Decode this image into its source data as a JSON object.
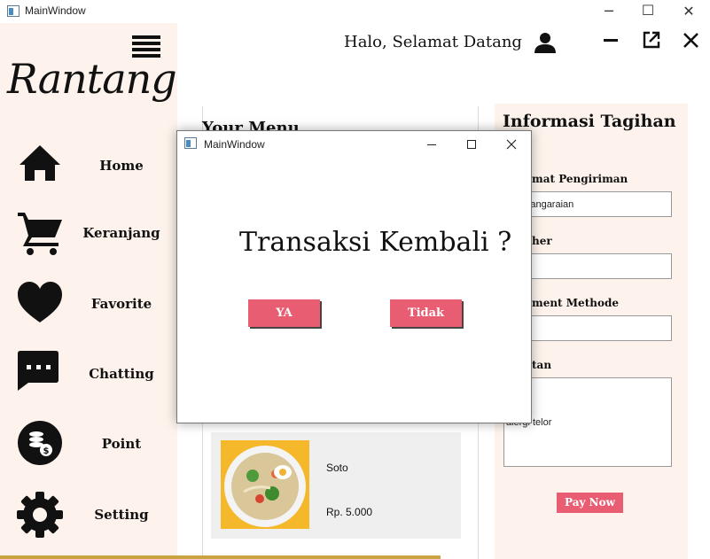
{
  "window": {
    "title": "MainWindow",
    "minimize": "─",
    "maximize": "☐",
    "close": "✕"
  },
  "app": {
    "logo": "Rantang",
    "greeting": "Halo, Selamat Datang",
    "header_minimize": "—",
    "header_popout": "⧉",
    "header_close": "✕"
  },
  "sidebar": {
    "items": [
      {
        "label": "Home",
        "icon": "home-icon"
      },
      {
        "label": "Keranjang",
        "icon": "cart-icon"
      },
      {
        "label": "Favorite",
        "icon": "heart-icon"
      },
      {
        "label": "Chatting",
        "icon": "chat-icon"
      },
      {
        "label": "Point",
        "icon": "coins-icon"
      },
      {
        "label": "Setting",
        "icon": "gear-icon"
      }
    ]
  },
  "menu": {
    "title": "Your Menu",
    "item": {
      "name": "Soto",
      "price": "Rp. 5.000"
    }
  },
  "billing": {
    "title": "Informasi Tagihan",
    "address_label": "mat Pengiriman",
    "address_value": "Pangaraian",
    "voucher_label": "her",
    "voucher_value": "",
    "payment_label": "ment Methode",
    "payment_value": "",
    "note_label": "tan",
    "note_value": "alergi telor",
    "pay_button": "Pay Now"
  },
  "dialog": {
    "title": "MainWindow",
    "message": "Transaksi Kembali ?",
    "yes": "YA",
    "no": "Tidak"
  },
  "colors": {
    "accent": "#e85d72",
    "sidebar_bg": "#fdf3ec",
    "food_bg": "#f5b82a"
  }
}
